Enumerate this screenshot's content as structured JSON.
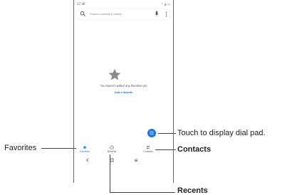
{
  "status_bar": {
    "time": "17:46",
    "icons": "⌔ ◭ ▭"
  },
  "search": {
    "placeholder": "Search contacts & places"
  },
  "empty_state": {
    "message": "You haven't added any favorites yet",
    "add_link": "Add a favorite"
  },
  "nav": {
    "tabs": [
      {
        "label": "Favorites",
        "icon": "star-icon",
        "active": true
      },
      {
        "label": "Recents",
        "icon": "clock-icon",
        "active": false
      },
      {
        "label": "Contacts",
        "icon": "people-icon",
        "active": false
      }
    ]
  },
  "callouts": {
    "dialpad": "Touch to display dial pad.",
    "favorites": "Favorites",
    "contacts": "Contacts",
    "recents": "Recents"
  },
  "colors": {
    "accent": "#1a73e8",
    "text": "#222222"
  }
}
